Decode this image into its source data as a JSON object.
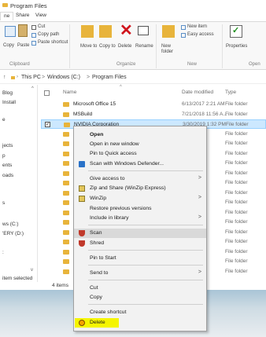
{
  "window": {
    "title": "Program Files"
  },
  "tabs": [
    "ne",
    "Share",
    "View"
  ],
  "ribbon": {
    "clipboard": {
      "cut": "Cut",
      "copy_path": "Copy path",
      "paste_shortcut": "Paste shortcut",
      "copy": "Copy",
      "paste": "Paste",
      "group": "Clipboard"
    },
    "organize": {
      "move_to": "Move to",
      "copy_to": "Copy to",
      "delete": "Delete",
      "rename": "Rename",
      "group": "Organize"
    },
    "new": {
      "new_folder": "New folder",
      "new_item": "New item",
      "easy_access": "Easy access",
      "group": "New"
    },
    "open": {
      "properties": "Properties",
      "group": "Open"
    }
  },
  "address": {
    "this_pc": "This PC",
    "sep1": ">",
    "windows_c": "Windows (C:)",
    "sep2": ">",
    "program_files": "Program Files"
  },
  "navpane": {
    "items": [
      "Blog",
      "Install",
      "e",
      "jects",
      "p",
      "ents",
      "oads",
      "s",
      "ws (C:)",
      "'ERY (D:)",
      ":"
    ]
  },
  "columns": {
    "name": "Name",
    "date_modified": "Date modified",
    "type": "Type"
  },
  "files": [
    {
      "name": "Microsoft Office 15",
      "date": "6/13/2017 2:21 AM",
      "type": "File folder"
    },
    {
      "name": "MSBuild",
      "date": "7/21/2018 11:56 A...",
      "type": "File folder"
    },
    {
      "name": "NVIDIA Corporation",
      "date": "3/30/2019 1:32 PM",
      "type": "File folder"
    },
    {
      "name": "Onli",
      "date": "PM",
      "type": "File folder"
    },
    {
      "name": "Rea",
      "date": "06 PM",
      "type": "File folder"
    },
    {
      "name": "Refe",
      "date": "56 A...",
      "type": "File folder"
    },
    {
      "name": "rem",
      "date": "0 PM",
      "type": "File folder"
    },
    {
      "name": "Win",
      "date": "8 PM",
      "type": "File folder"
    },
    {
      "name": "Win",
      "date": "06 PM",
      "type": "File folder"
    },
    {
      "name": "Win",
      "date": "8 PM",
      "type": "File folder"
    },
    {
      "name": "Win",
      "date": "8 PM",
      "type": "File folder"
    },
    {
      "name": "wind",
      "date": "8 PM",
      "type": "File folder"
    },
    {
      "name": "Win",
      "date": "04 PM",
      "type": "File folder"
    },
    {
      "name": "Win",
      "date": "8 PM",
      "type": "File folder"
    },
    {
      "name": "Win",
      "date": "8 PM",
      "type": "File folder"
    },
    {
      "name": "Win",
      "date": "8 PM",
      "type": "File folder"
    },
    {
      "name": "Win",
      "date": "8 PM",
      "type": "File folder"
    },
    {
      "name": "Win",
      "date": "PM",
      "type": "File folder"
    }
  ],
  "status": {
    "count": "4 items",
    "selection": "item selected"
  },
  "context_menu": {
    "open": "Open",
    "open_new_window": "Open in new window",
    "pin_quick_access": "Pin to Quick access",
    "scan_defender": "Scan with Windows Defender...",
    "give_access": "Give access to",
    "zip_share": "Zip and Share (WinZip Express)",
    "winzip": "WinZip",
    "restore_versions": "Restore previous versions",
    "include_library": "Include in library",
    "scan": "Scan",
    "shred": "Shred",
    "pin_start": "Pin to Start",
    "send_to": "Send to",
    "cut": "Cut",
    "copy": "Copy",
    "create_shortcut": "Create shortcut",
    "delete": "Delete",
    "arrow": ">"
  },
  "colors": {
    "folder": "#e8b43b",
    "selection": "#cce8ff",
    "highlight": "#f5f500",
    "menu_bg": "#f2f2f2",
    "shield_red": "#c0392b"
  }
}
